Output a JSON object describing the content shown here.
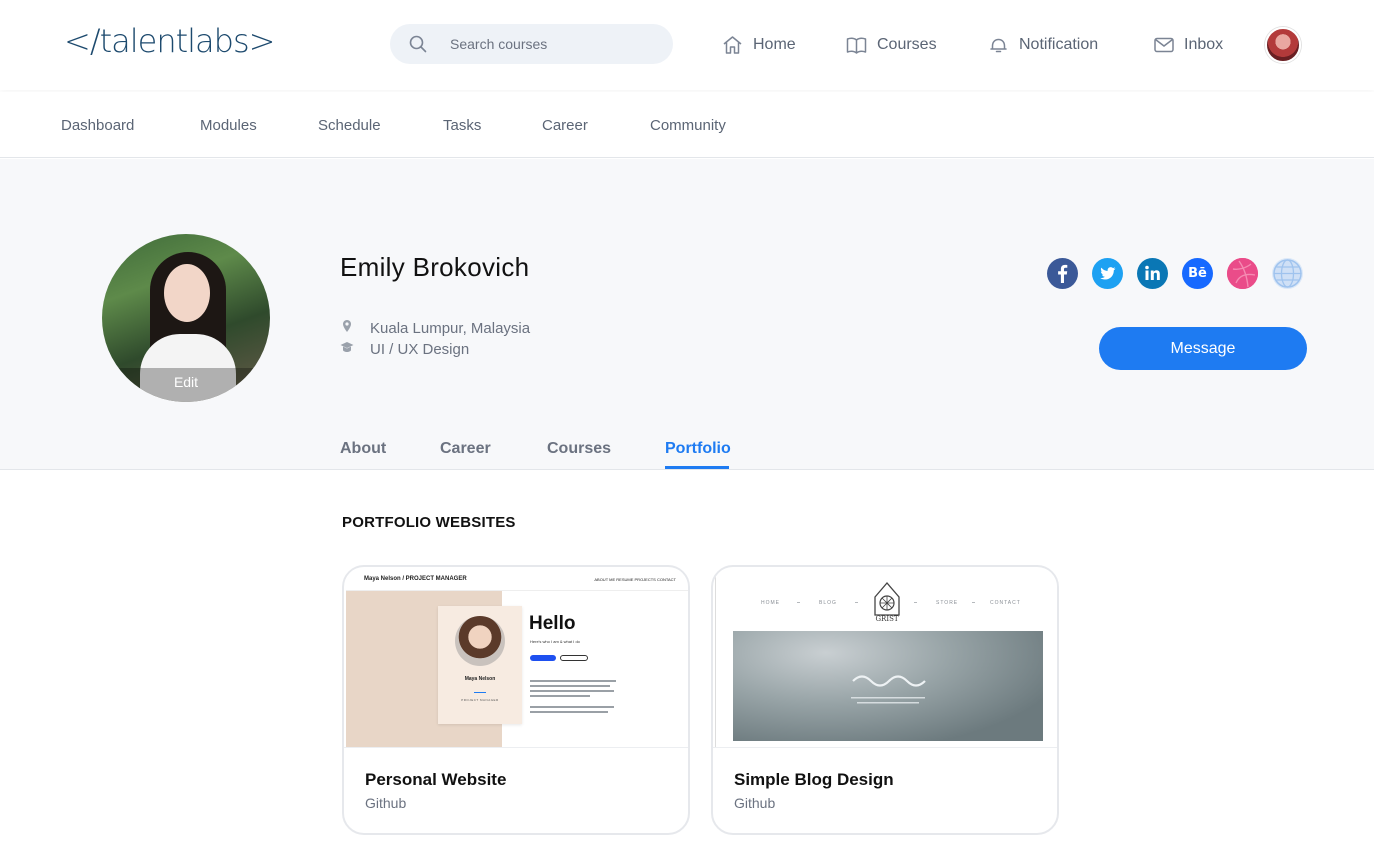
{
  "header": {
    "logo": "</talentlabs>",
    "search": {
      "placeholder": "Search courses",
      "value": ""
    },
    "nav": [
      {
        "label": "Home",
        "icon": "home-icon"
      },
      {
        "label": "Courses",
        "icon": "book-icon"
      },
      {
        "label": "Notification",
        "icon": "bell-icon"
      },
      {
        "label": "Inbox",
        "icon": "mail-icon"
      }
    ]
  },
  "subnav": [
    "Dashboard",
    "Modules",
    "Schedule",
    "Tasks",
    "Career",
    "Community"
  ],
  "profile": {
    "name": "Emily Brokovich",
    "location": "Kuala Lumpur, Malaysia",
    "role": "UI / UX Design",
    "edit_label": "Edit",
    "message_label": "Message",
    "socials": [
      {
        "name": "facebook",
        "color": "#3b5998"
      },
      {
        "name": "twitter",
        "color": "#1da1f2"
      },
      {
        "name": "linkedin",
        "color": "#0a77b5"
      },
      {
        "name": "behance",
        "color": "#1769ff"
      },
      {
        "name": "dribbble",
        "color": "#ea4c89"
      },
      {
        "name": "website",
        "color": "#9fc3ee"
      }
    ],
    "tabs": [
      "About",
      "Career",
      "Courses",
      "Portfolio"
    ],
    "active_tab": "Portfolio"
  },
  "portfolio": {
    "section_title": "PORTFOLIO WEBSITES",
    "items": [
      {
        "title": "Personal Website",
        "subtitle": "Github",
        "preview": {
          "brand": "Maya Nelson / PROJECT MANAGER",
          "heading": "Hello",
          "tagline": "Here's who I am & what I do",
          "card_name": "Maya Nelson",
          "card_role": "PROJECT MANAGER",
          "links": "ABOUT ME  RESUME  PROJECTS  CONTACT"
        }
      },
      {
        "title": "Simple Blog Design",
        "subtitle": "Github",
        "preview": {
          "nav": [
            "HOME",
            "BLOG",
            "STORE",
            "CONTACT"
          ],
          "brand": "GRIST"
        }
      }
    ]
  },
  "colors": {
    "accent": "#1e7bf2",
    "text_muted": "#6b7280",
    "band_bg": "#f7f8fa"
  }
}
